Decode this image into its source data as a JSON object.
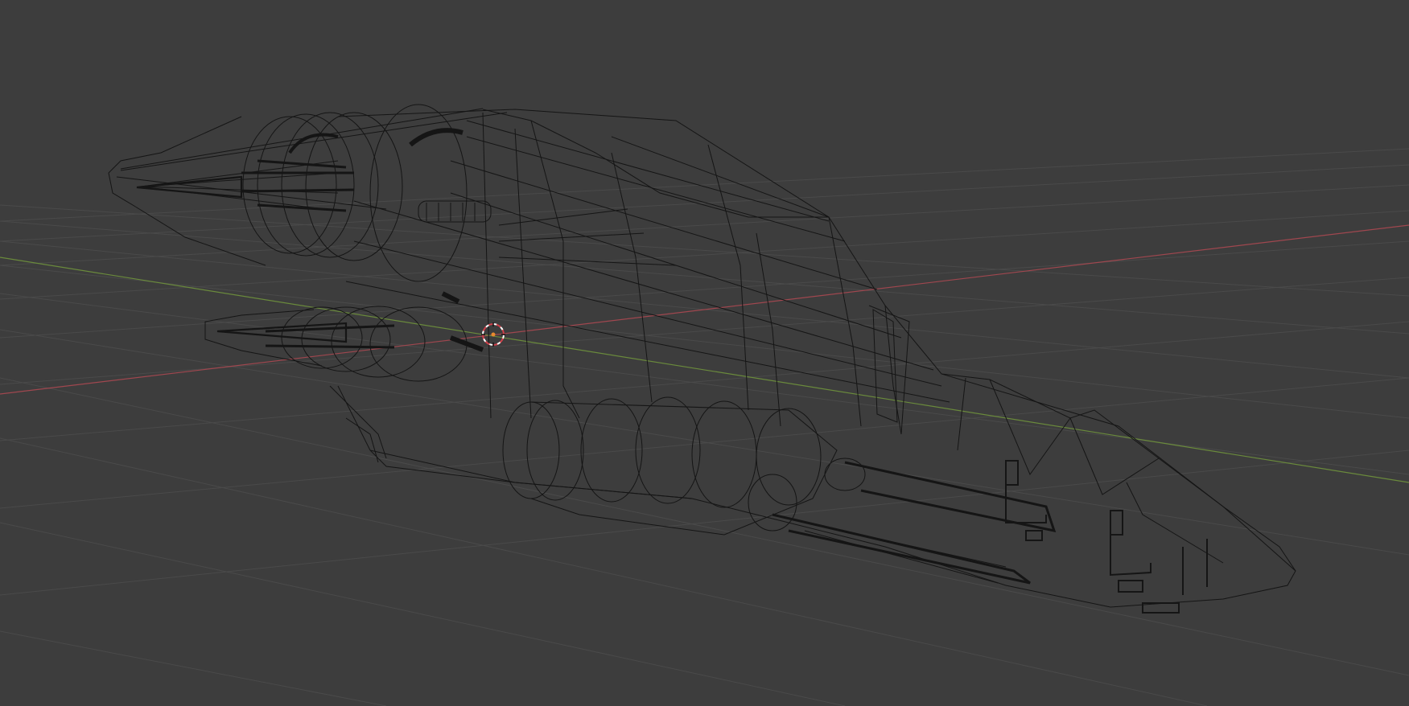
{
  "viewport": {
    "mode": "wireframe",
    "background_color": "#3d3d3d",
    "grid_color": "#4a4a4a",
    "x_axis_color": "#a0474f",
    "y_axis_color": "#6a8a3c",
    "wire_color": "#151515",
    "cursor_icon": "3d-cursor-icon"
  }
}
